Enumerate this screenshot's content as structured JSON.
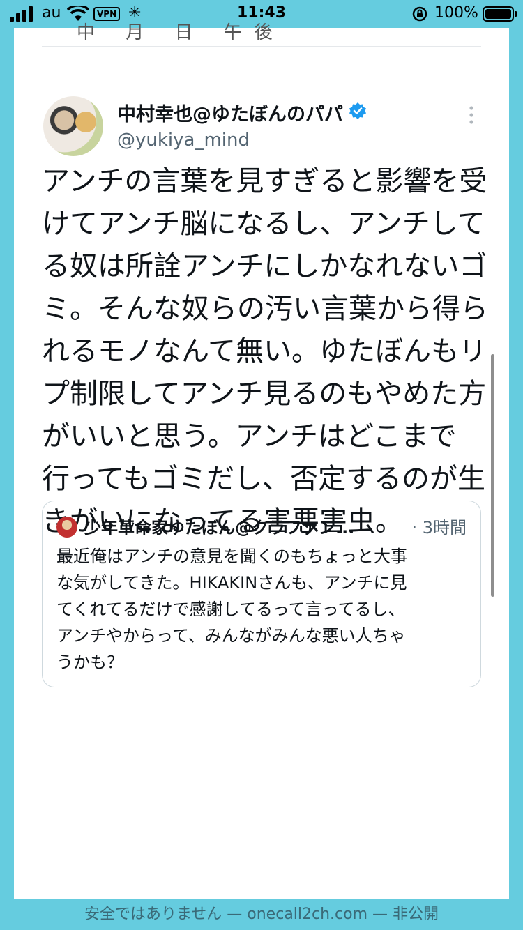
{
  "status_bar": {
    "carrier": "au",
    "vpn": "VPN",
    "time": "11:43",
    "battery": "100%",
    "icons": [
      "signal-icon",
      "wifi-icon",
      "spinner-icon",
      "rotation-lock-icon",
      "battery-icon"
    ]
  },
  "previous_tweet_fragment": "中 月 日 午後",
  "tweet": {
    "display_name": "中村幸也@ゆたぼんのパパ",
    "handle": "@yukiya_mind",
    "verified": true,
    "body": "アンチの言葉を見すぎると影響を受\nけてアンチ脳になるし、アンチして\nる奴は所詮アンチにしかなれないゴ\nミ。そんな奴らの汚い言葉から得ら\nれるモノなんて無い。ゆたぼんもリ\nプ制限してアンチ見るのもやめた方\nがいいと思う。アンチはどこまで\n行ってもゴミだし、否定するのが生\nきがいになってる害悪害虫。"
  },
  "quoted_tweet": {
    "display_name": "少年革命家ゆたぼん@クラファン...",
    "time": "· 3時間",
    "body": "最近俺はアンチの意見を聞くのもちょっと大事\nな気がしてきた。HIKAKINさんも、アンチに見\nてくれてるだけで感謝してるって言ってるし、\nアンチやからって、みんながみんな悪い人ちゃ\nうかも？"
  },
  "url_bar": {
    "text": "安全ではありません — onecall2ch.com — 非公開"
  },
  "colors": {
    "frame": "#65CCDF",
    "verified": "#1D9BF0",
    "secondary_text": "#536471"
  }
}
